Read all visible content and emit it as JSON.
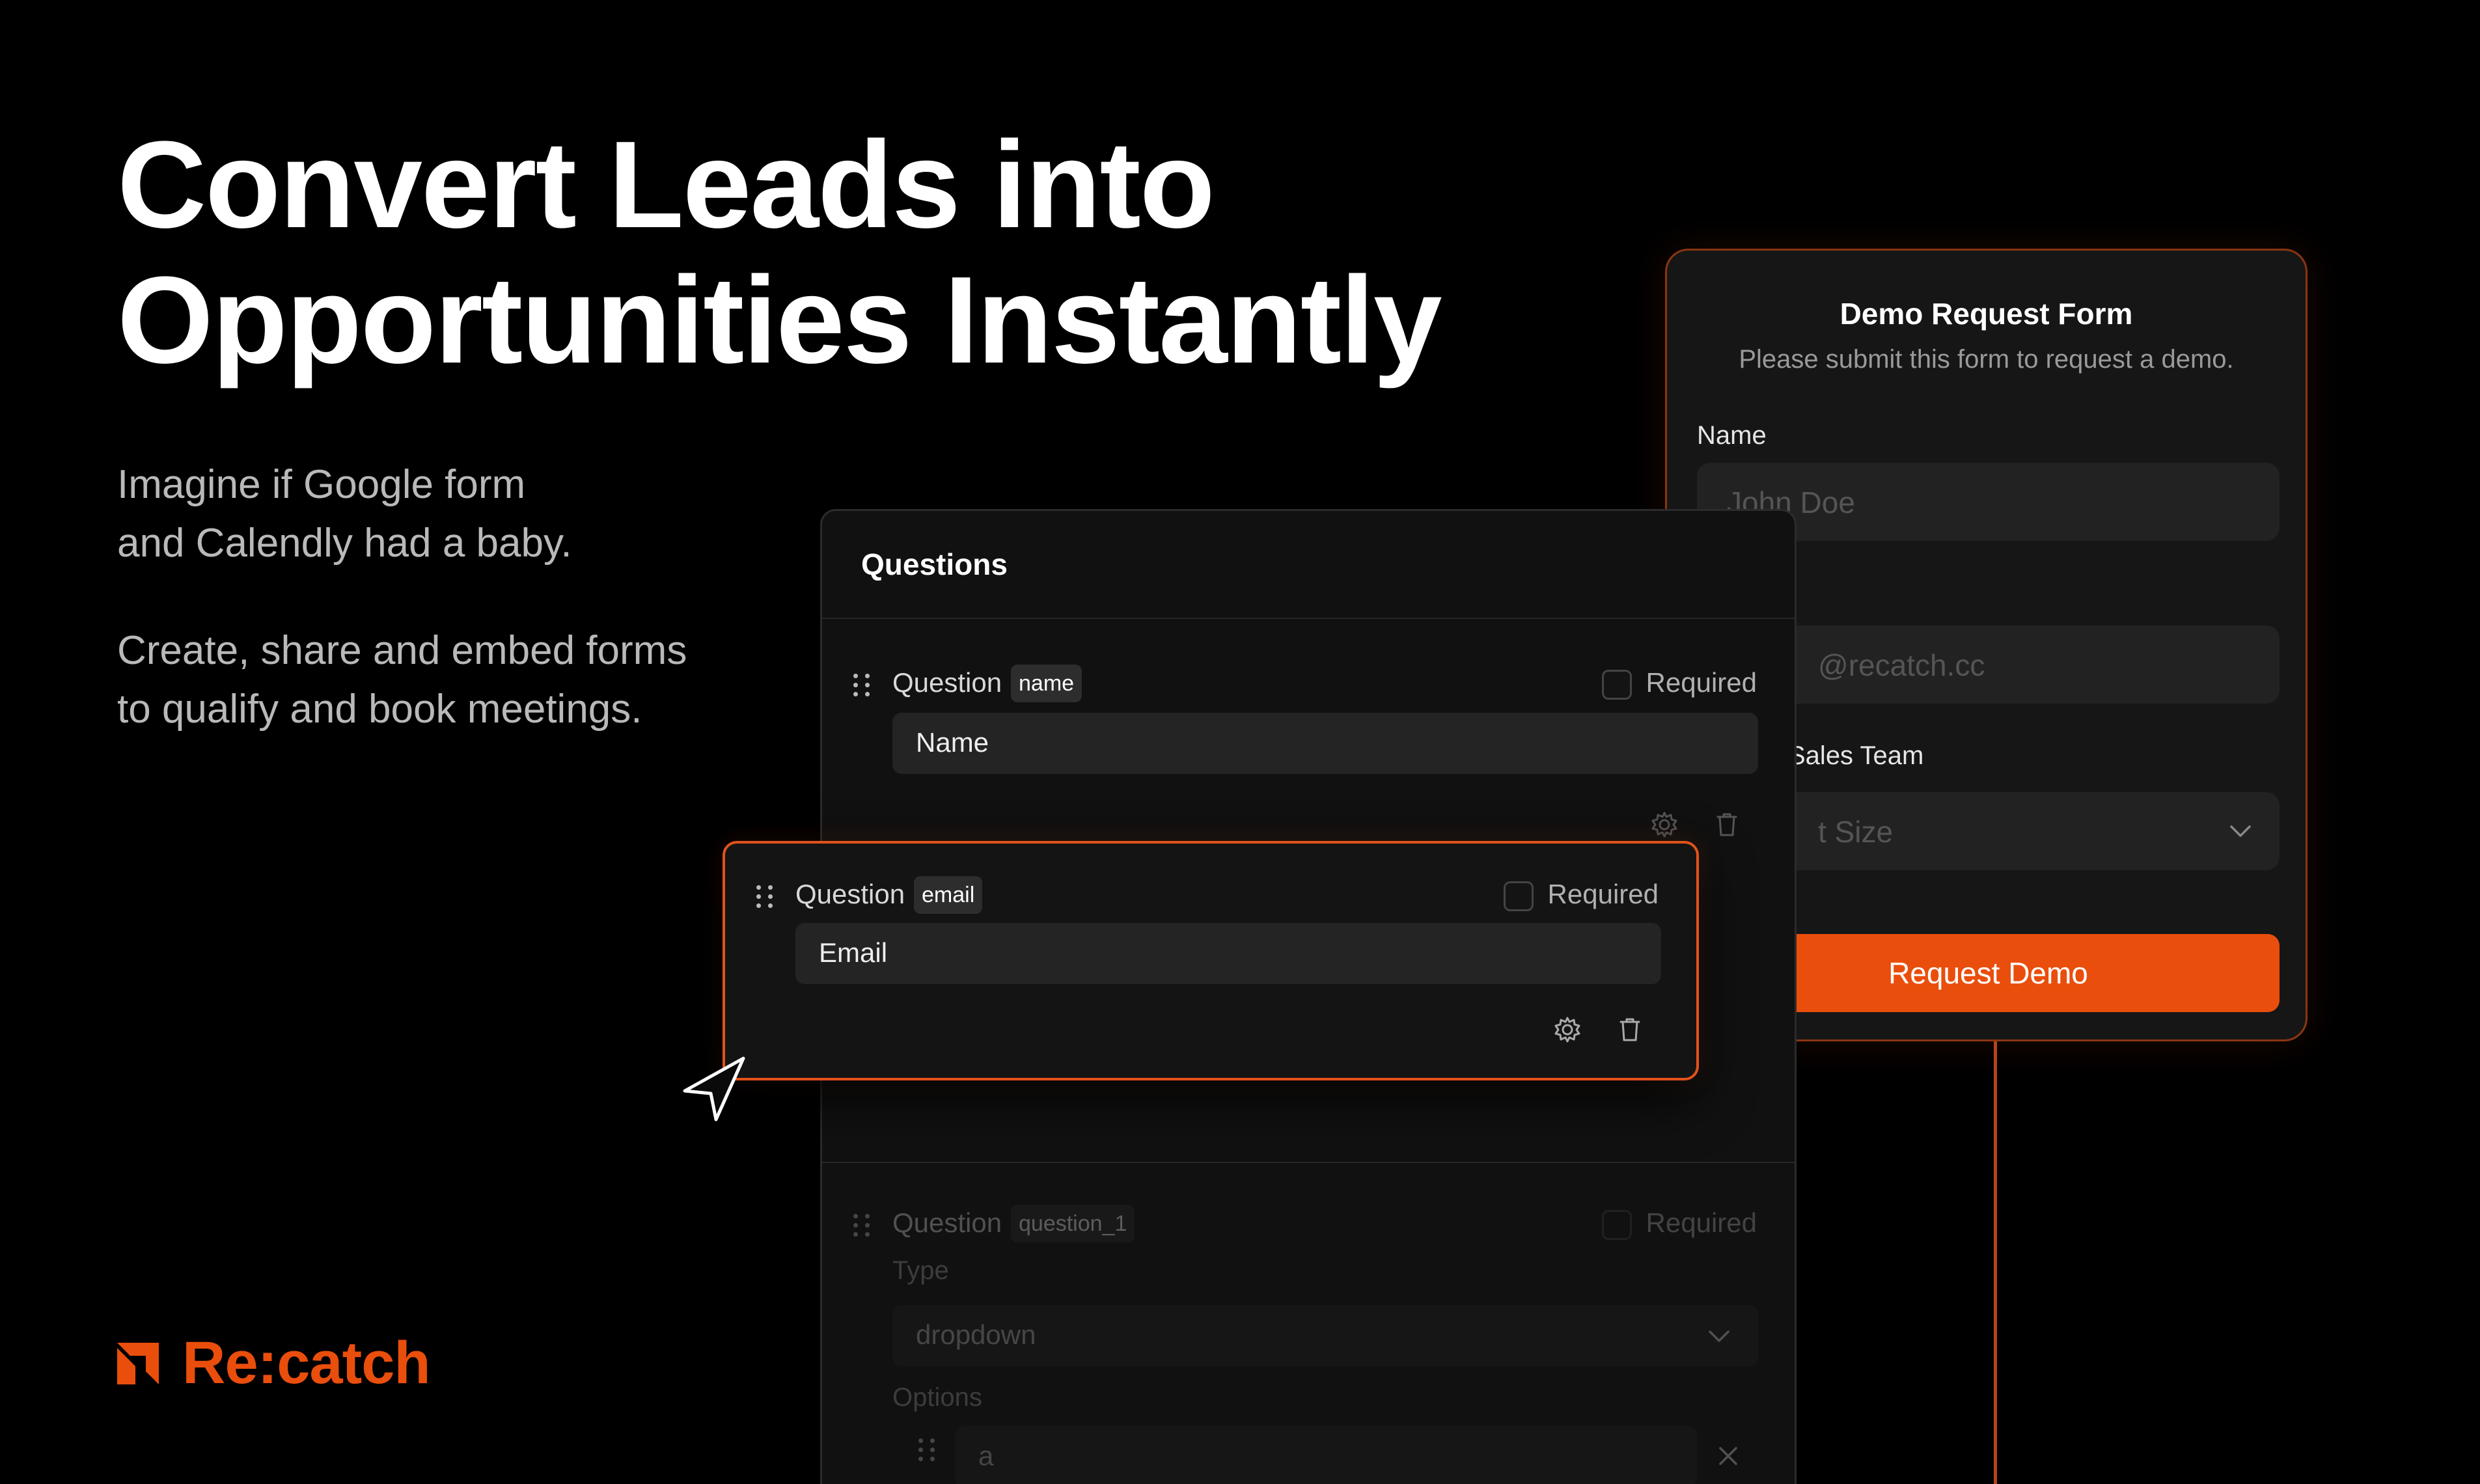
{
  "hero": {
    "headline_line1": "Convert Leads into",
    "headline_line2": "Opportunities Instantly",
    "tagline_1a": "Imagine if Google form",
    "tagline_1b": "and Calendly had a baby.",
    "tagline_2a": "Create, share and embed forms",
    "tagline_2b": "to qualify and book meetings."
  },
  "brand": {
    "name": "Re:catch",
    "accent_color": "#ea4e0c"
  },
  "demo_form": {
    "title": "Demo Request Form",
    "subtitle": "Please submit this form to request a demo.",
    "name_label": "Name",
    "name_placeholder": "John Doe",
    "email_placeholder": "@recatch.cc",
    "team_label": "Sales Team",
    "team_placeholder": "t Size",
    "submit_label": "Request Demo"
  },
  "questions_panel": {
    "title": "Questions",
    "q1": {
      "word": "Question",
      "key": "name",
      "required_label": "Required",
      "value": "Name"
    },
    "q2": {
      "word": "Question",
      "key": "email",
      "required_label": "Required",
      "value": "Email"
    },
    "q3": {
      "word": "Question",
      "key": "question_1",
      "required_label": "Required",
      "type_label": "Type",
      "type_value": "dropdown",
      "options_label": "Options",
      "option_value": "a"
    }
  },
  "icons": [
    "drag-handle-icon",
    "settings-gear-icon",
    "trash-icon",
    "chevron-down-icon",
    "close-x-icon",
    "cursor-pointer-icon",
    "recatch-logo-icon"
  ]
}
